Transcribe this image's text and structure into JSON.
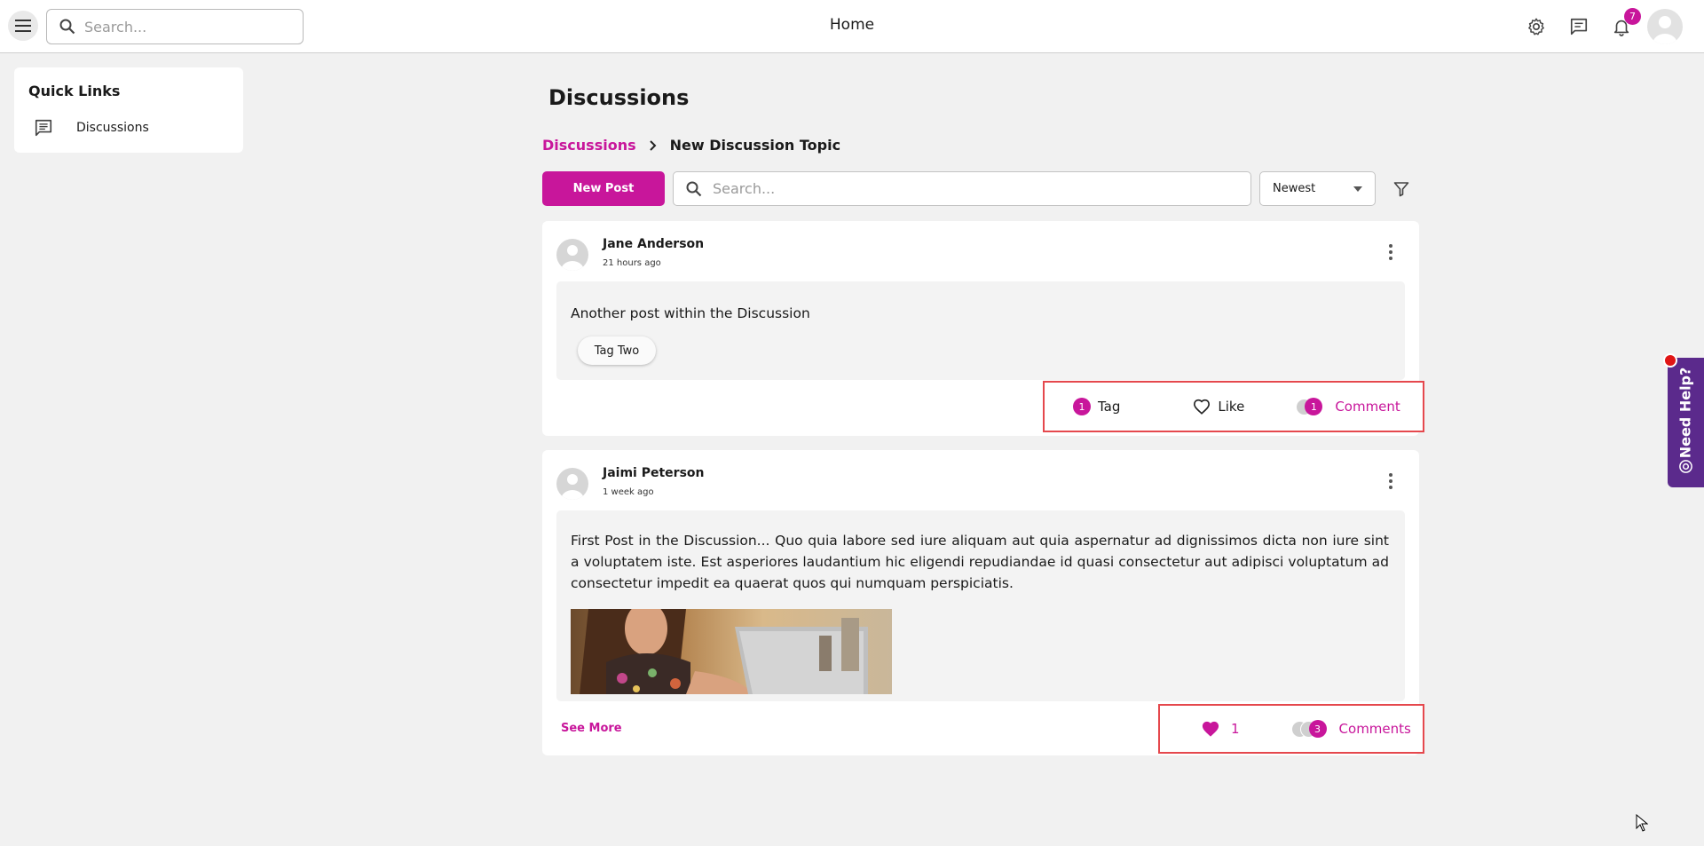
{
  "topbar": {
    "menu_icon": "hamburger-icon",
    "search_placeholder": "Search...",
    "title": "Home",
    "notification_count": "7",
    "icons": [
      "gear-icon",
      "chat-icon",
      "bell-icon",
      "avatar"
    ]
  },
  "quick_links": {
    "title": "Quick Links",
    "items": [
      {
        "label": "Discussions",
        "icon": "chat-icon"
      }
    ]
  },
  "main": {
    "title": "Discussions",
    "breadcrumb": {
      "parent": "Discussions",
      "current": "New Discussion Topic"
    },
    "new_post_label": "New Post",
    "search_placeholder": "Search...",
    "sort_value": "Newest"
  },
  "posts": [
    {
      "author": "Jane Anderson",
      "time": "21 hours ago",
      "text": "Another post within the Discussion",
      "tags": [
        "Tag Two"
      ],
      "tag_count": "1",
      "tag_label": "Tag",
      "like_label": "Like",
      "comment_count": "1",
      "comment_label": "Comment"
    },
    {
      "author": "Jaimi Peterson",
      "time": "1 week ago",
      "text": "First Post in the Discussion... Quo quia labore sed iure aliquam aut quia aspernatur ad dignissimos dicta non iure sint a voluptatem iste. Est asperiores laudantium hic eligendi repudiandae id quasi consectetur aut adipisci voluptatum ad consectetur impedit ea quaerat quos qui numquam perspiciatis.",
      "see_more_label": "See More",
      "like_count": "1",
      "comment_count": "3",
      "comment_label": "Comments"
    }
  ],
  "help": {
    "label": "Need Help?"
  },
  "colors": {
    "accent": "#c8169b",
    "help_tab": "#5b2a8c",
    "highlight": "#e5484d"
  }
}
